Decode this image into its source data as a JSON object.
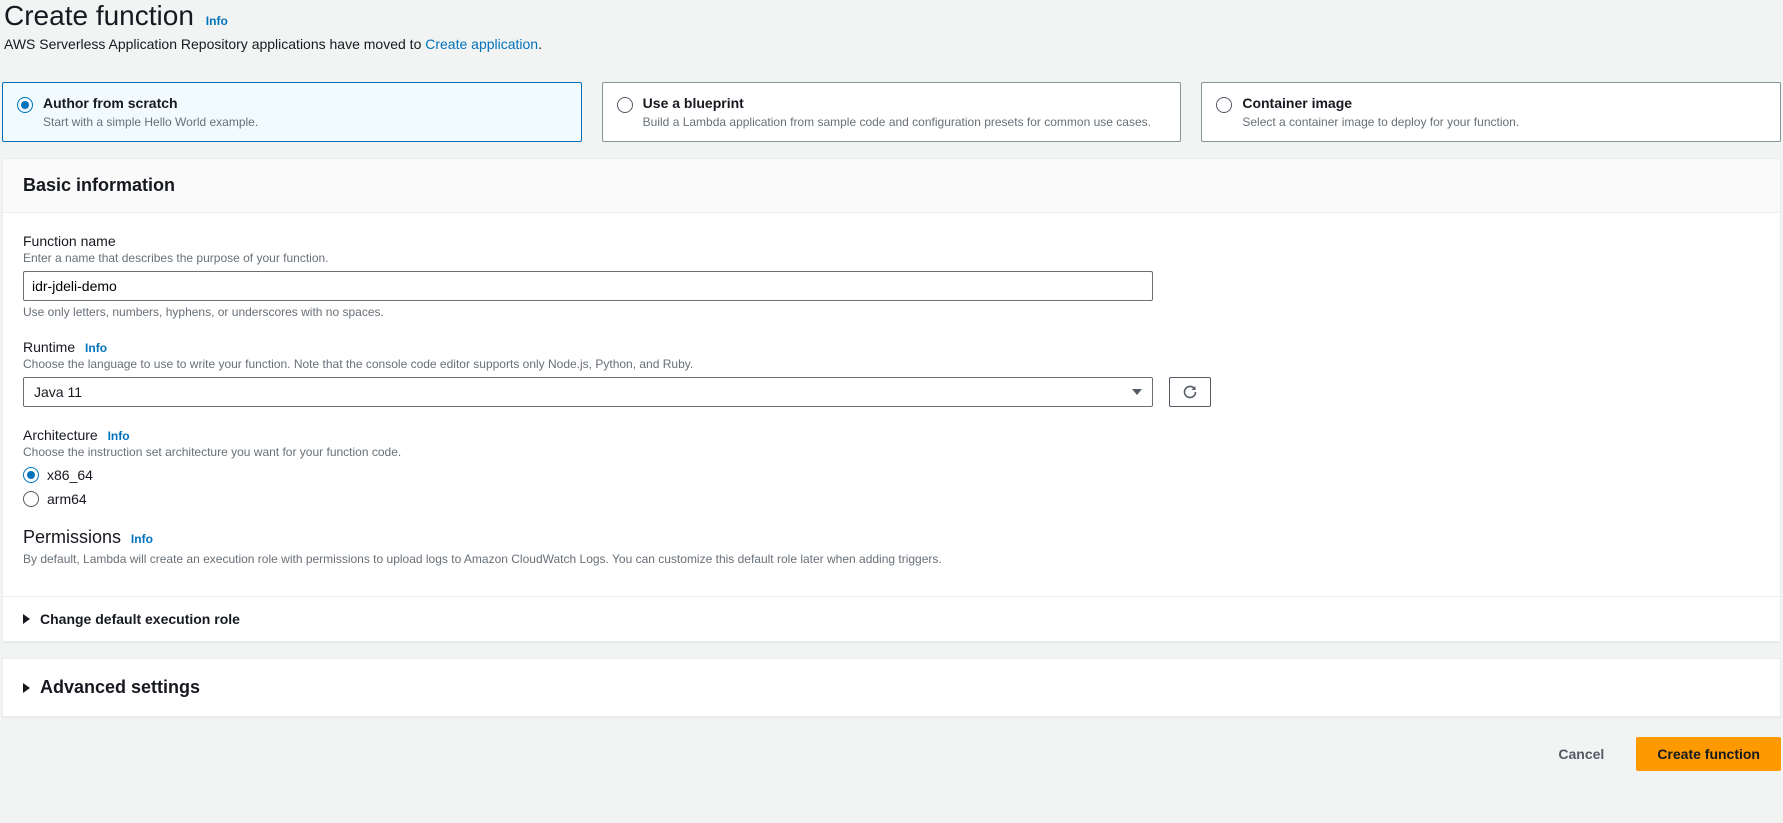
{
  "header": {
    "title": "Create function",
    "info": "Info",
    "subtext_prefix": "AWS Serverless Application Repository applications have moved to ",
    "subtext_link": "Create application",
    "subtext_suffix": "."
  },
  "options": [
    {
      "title": "Author from scratch",
      "sub": "Start with a simple Hello World example.",
      "selected": true
    },
    {
      "title": "Use a blueprint",
      "sub": "Build a Lambda application from sample code and configuration presets for common use cases.",
      "selected": false
    },
    {
      "title": "Container image",
      "sub": "Select a container image to deploy for your function.",
      "selected": false
    }
  ],
  "basic": {
    "heading": "Basic information",
    "function_name": {
      "label": "Function name",
      "hint": "Enter a name that describes the purpose of your function.",
      "value": "idr-jdeli-demo",
      "constraint": "Use only letters, numbers, hyphens, or underscores with no spaces."
    },
    "runtime": {
      "label": "Runtime",
      "info": "Info",
      "hint": "Choose the language to use to write your function. Note that the console code editor supports only Node.js, Python, and Ruby.",
      "value": "Java 11"
    },
    "architecture": {
      "label": "Architecture",
      "info": "Info",
      "hint": "Choose the instruction set architecture you want for your function code.",
      "options": [
        {
          "label": "x86_64",
          "selected": true
        },
        {
          "label": "arm64",
          "selected": false
        }
      ]
    },
    "permissions": {
      "label": "Permissions",
      "info": "Info",
      "desc": "By default, Lambda will create an execution role with permissions to upload logs to Amazon CloudWatch Logs. You can customize this default role later when adding triggers."
    },
    "change_role": "Change default execution role"
  },
  "advanced": {
    "label": "Advanced settings"
  },
  "footer": {
    "cancel": "Cancel",
    "create": "Create function"
  }
}
